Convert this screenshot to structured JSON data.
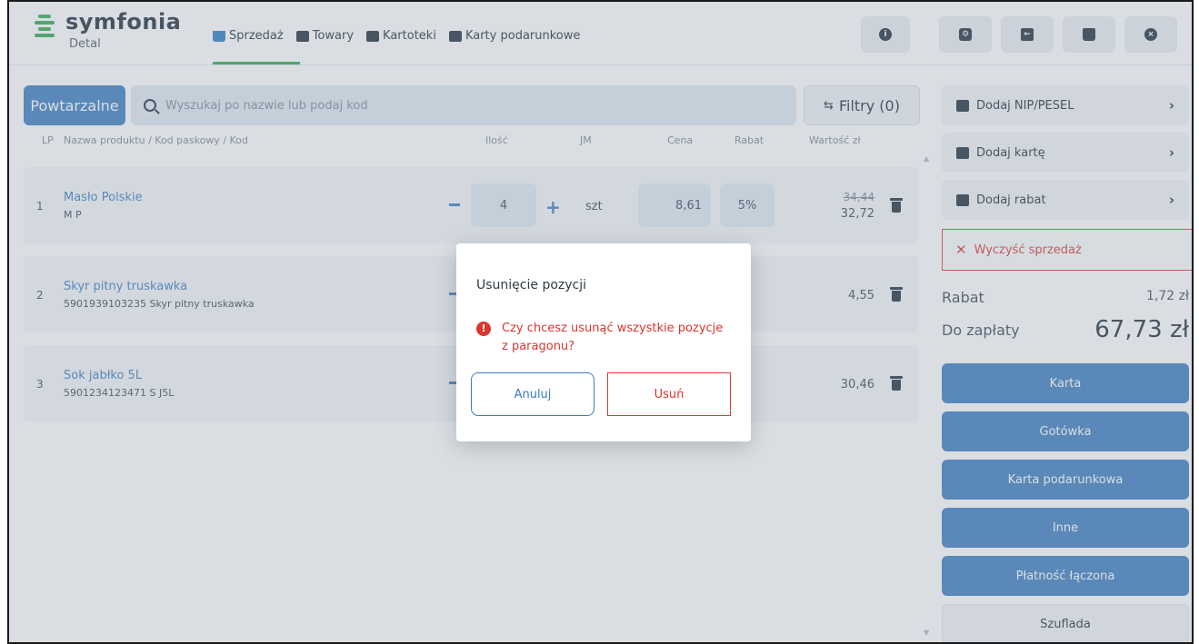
{
  "app": {
    "logo_text": "symfonia",
    "logo_sub": "Detal"
  },
  "nav": [
    {
      "label": "Sprzedaż"
    },
    {
      "label": "Towary"
    },
    {
      "label": "Kartoteki"
    },
    {
      "label": "Karty podarunkowe"
    }
  ],
  "search": {
    "repeat_label": "Powtarzalne",
    "placeholder": "Wyszukaj po nazwie lub podaj kod",
    "filters_label": "Filtry (0)"
  },
  "table": {
    "headers": {
      "lp": "LP",
      "name": "Nazwa produktu / Kod paskowy / Kod",
      "qty": "Ilość",
      "jm": "JM",
      "price": "Cena",
      "discount": "Rabat",
      "value": "Wartość zł"
    },
    "rows": [
      {
        "lp": "1",
        "name": "Masło Polskie",
        "code": "M P",
        "qty": "4",
        "jm": "szt",
        "price": "8,61",
        "discount": "5%",
        "old_value": "34,44",
        "value": "32,72"
      },
      {
        "lp": "2",
        "name": "Skyr pitny truskawka",
        "code": "5901939103235 Skyr pitny truskawka",
        "value": "4,55"
      },
      {
        "lp": "3",
        "name": "Sok jabłko 5L",
        "code": "5901234123471 S J5L",
        "value": "30,46"
      }
    ]
  },
  "right_panel": {
    "add_nip": "Dodaj NIP/PESEL",
    "add_card": "Dodaj kartę",
    "add_discount": "Dodaj rabat",
    "clear_sale": "Wyczyść sprzedaż",
    "discount_label": "Rabat",
    "discount_value": "1,72 zł",
    "to_pay_label": "Do zapłaty",
    "to_pay_value": "67,73 zł",
    "payments": [
      "Karta",
      "Gotówka",
      "Karta podarunkowa",
      "Inne",
      "Płatność łączona"
    ],
    "drawer": "Szuflada"
  },
  "modal": {
    "title": "Usunięcie pozycji",
    "message": "Czy chcesz usunąć wszystkie pozycje z paragonu?",
    "cancel": "Anuluj",
    "confirm": "Usuń"
  },
  "colors": {
    "accent": "#3a7cc0",
    "brand_green": "#2fa84f",
    "danger": "#d9362f"
  }
}
